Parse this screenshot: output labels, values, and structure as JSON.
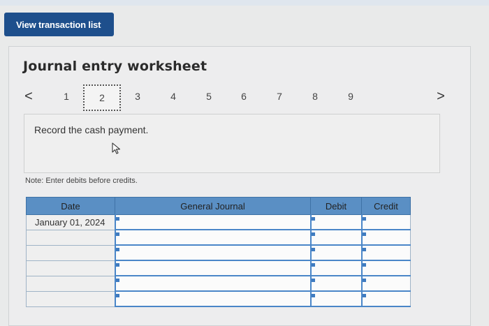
{
  "header": {
    "view_transaction_list": "View transaction list"
  },
  "worksheet": {
    "title": "Journal entry worksheet",
    "pager": {
      "prev": "<",
      "next": ">",
      "pages": [
        "1",
        "2",
        "3",
        "4",
        "5",
        "6",
        "7",
        "8",
        "9"
      ],
      "active_page": "2"
    },
    "instruction": "Record the cash payment.",
    "note": "Note: Enter debits before credits."
  },
  "journal": {
    "columns": {
      "date": "Date",
      "general_journal": "General Journal",
      "debit": "Debit",
      "credit": "Credit"
    },
    "rows": [
      {
        "date": "January 01, 2024",
        "account": "",
        "debit": "",
        "credit": ""
      },
      {
        "date": "",
        "account": "",
        "debit": "",
        "credit": ""
      },
      {
        "date": "",
        "account": "",
        "debit": "",
        "credit": ""
      },
      {
        "date": "",
        "account": "",
        "debit": "",
        "credit": ""
      },
      {
        "date": "",
        "account": "",
        "debit": "",
        "credit": ""
      },
      {
        "date": "",
        "account": "",
        "debit": "",
        "credit": ""
      }
    ]
  },
  "colors": {
    "button_bg": "#1e4f8c",
    "table_header": "#5a8fc4",
    "input_border": "#4a86c8"
  }
}
